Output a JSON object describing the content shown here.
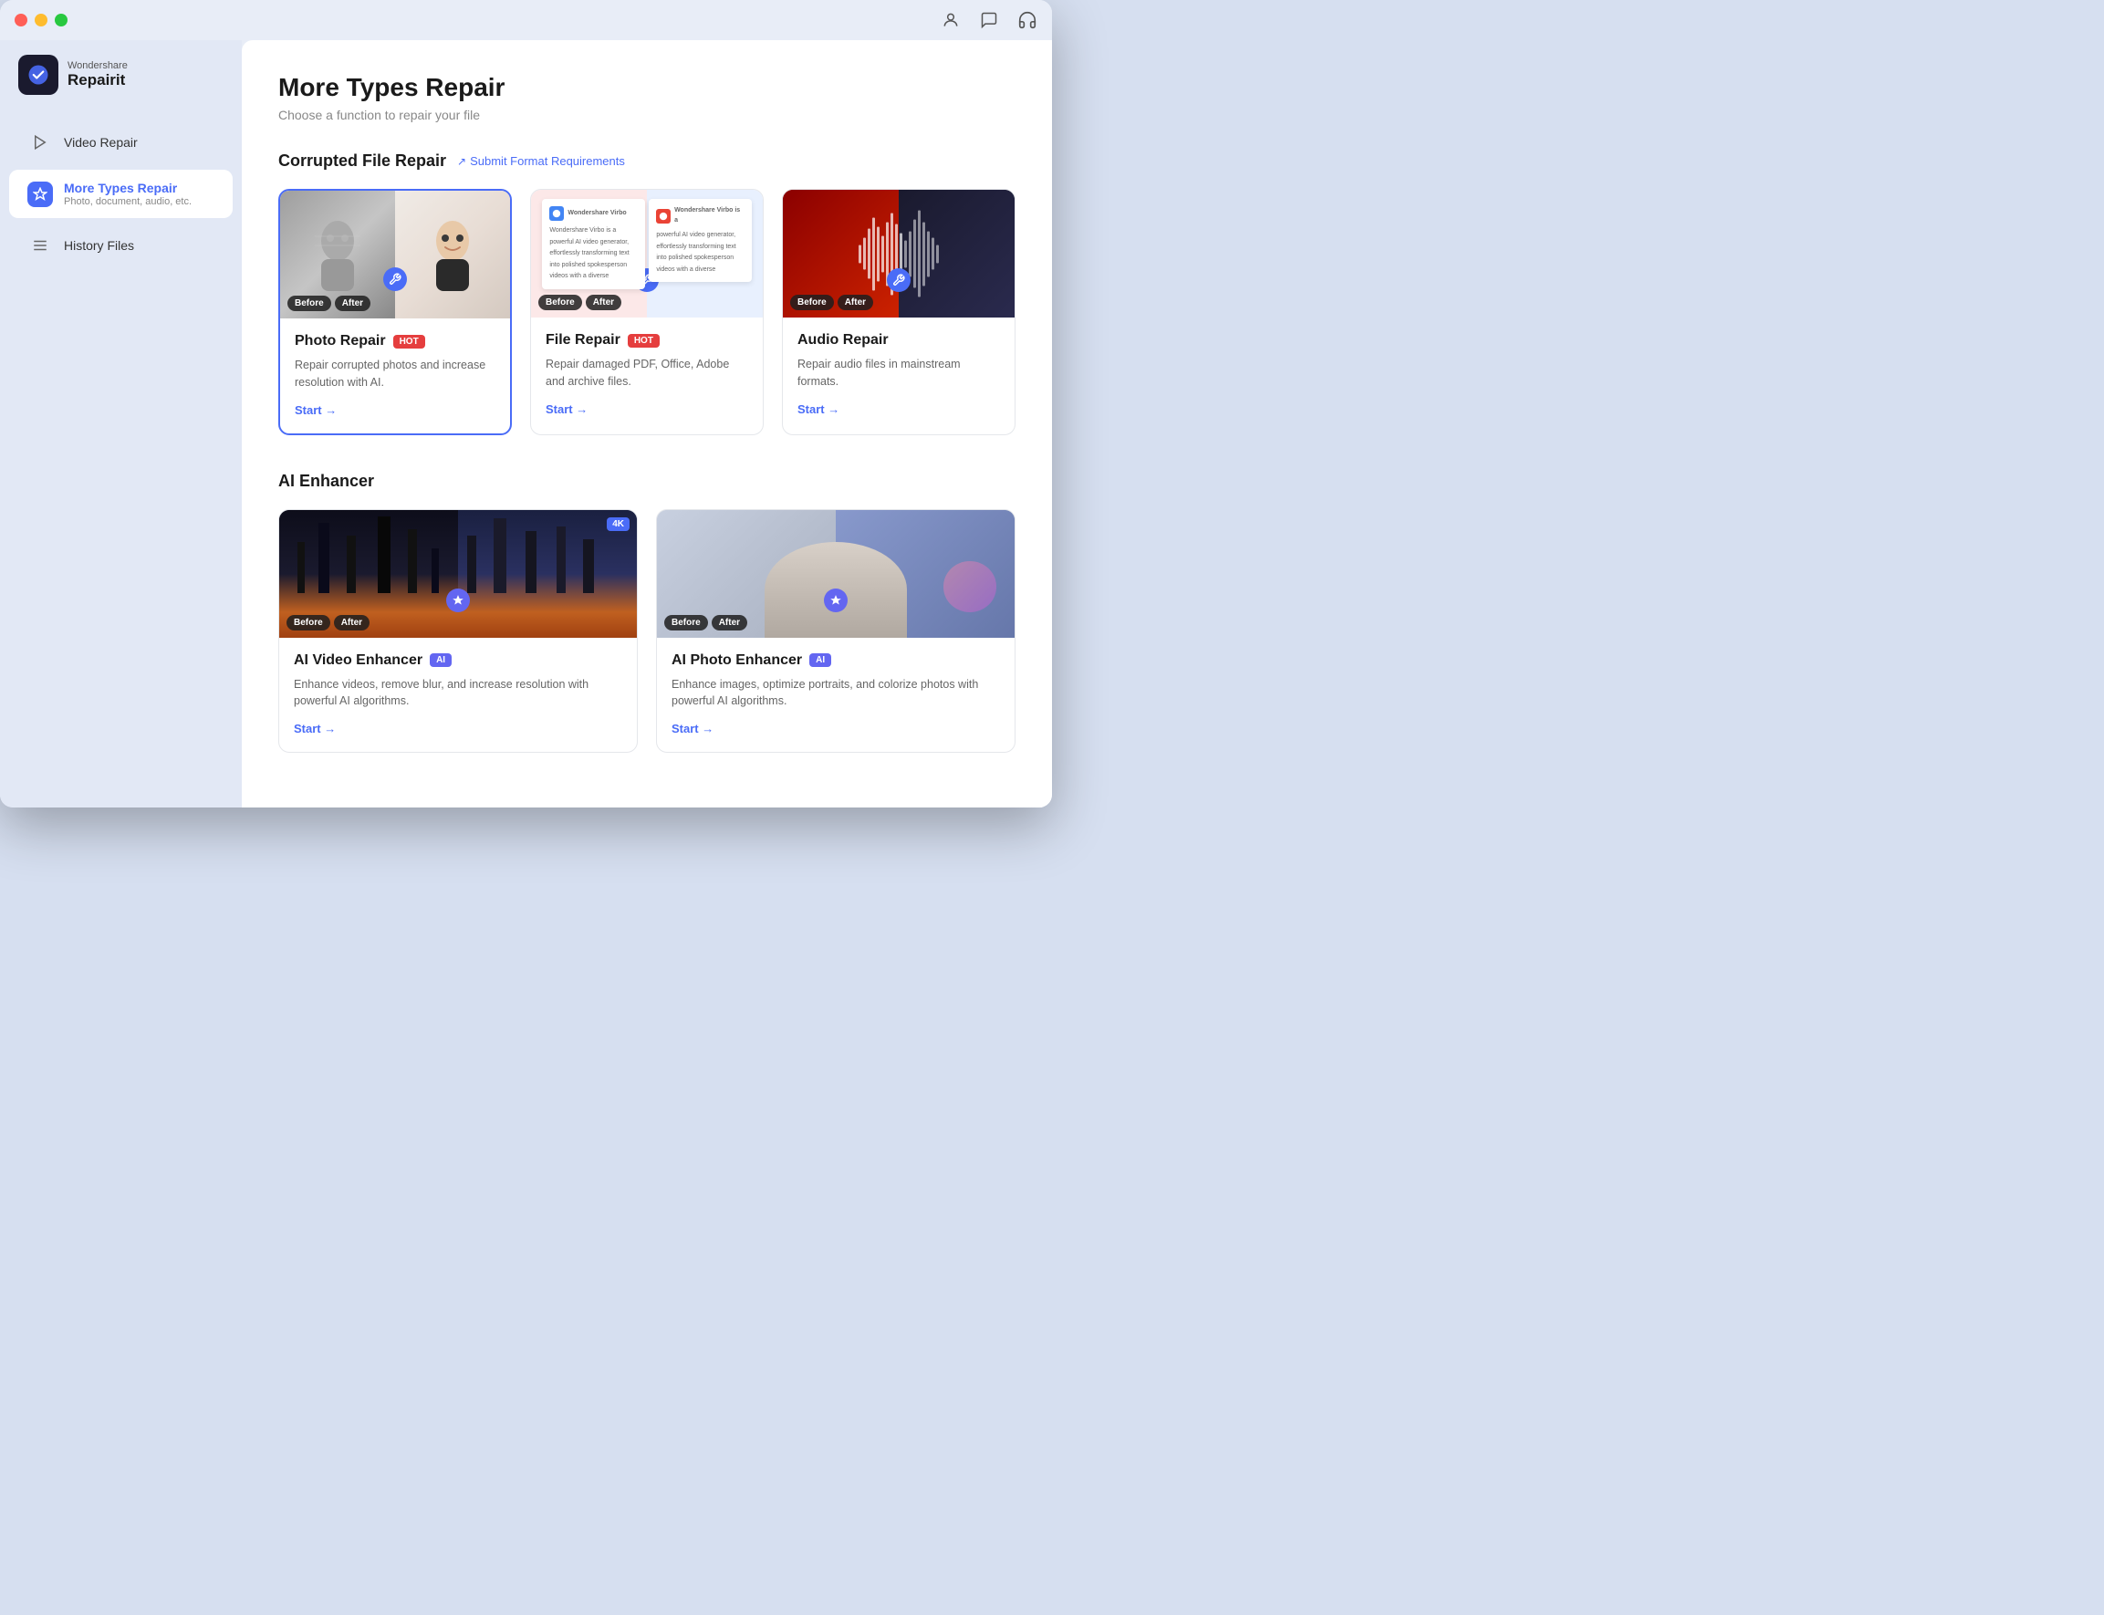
{
  "app": {
    "name": "Repairit",
    "brand": "Wondershare"
  },
  "titlebar": {
    "icons": [
      "person-icon",
      "chat-icon",
      "headphone-icon"
    ]
  },
  "sidebar": {
    "items": [
      {
        "id": "video-repair",
        "label": "Video Repair",
        "sublabel": null,
        "active": false
      },
      {
        "id": "more-types-repair",
        "label": "More Types Repair",
        "sublabel": "Photo, document, audio, etc.",
        "active": true
      },
      {
        "id": "history-files",
        "label": "History Files",
        "sublabel": null,
        "active": false
      }
    ]
  },
  "main": {
    "title": "More Types Repair",
    "subtitle": "Choose a function to repair your file",
    "sections": [
      {
        "id": "corrupted-file-repair",
        "title": "Corrupted File Repair",
        "submit_link": "Submit Format Requirements",
        "cards": [
          {
            "id": "photo-repair",
            "title": "Photo Repair",
            "badge": "HOT",
            "badge_type": "hot",
            "description": "Repair corrupted photos and increase resolution with AI.",
            "start_label": "Start →",
            "selected": true
          },
          {
            "id": "file-repair",
            "title": "File Repair",
            "badge": "HOT",
            "badge_type": "hot",
            "description": "Repair damaged PDF, Office, Adobe and archive files.",
            "start_label": "Start →",
            "selected": false
          },
          {
            "id": "audio-repair",
            "title": "Audio Repair",
            "badge": null,
            "badge_type": null,
            "description": "Repair audio files in mainstream formats.",
            "start_label": "Start →",
            "selected": false
          }
        ]
      },
      {
        "id": "ai-enhancer",
        "title": "AI Enhancer",
        "cards": [
          {
            "id": "ai-video-enhancer",
            "title": "AI Video Enhancer",
            "badge": "AI",
            "badge_type": "ai",
            "description": "Enhance videos, remove blur, and increase resolution with powerful AI algorithms.",
            "start_label": "Start →",
            "selected": false
          },
          {
            "id": "ai-photo-enhancer",
            "title": "AI Photo Enhancer",
            "badge": "AI",
            "badge_type": "ai",
            "description": "Enhance images, optimize portraits, and colorize photos with powerful AI algorithms.",
            "start_label": "Start →",
            "selected": false
          }
        ]
      }
    ]
  }
}
